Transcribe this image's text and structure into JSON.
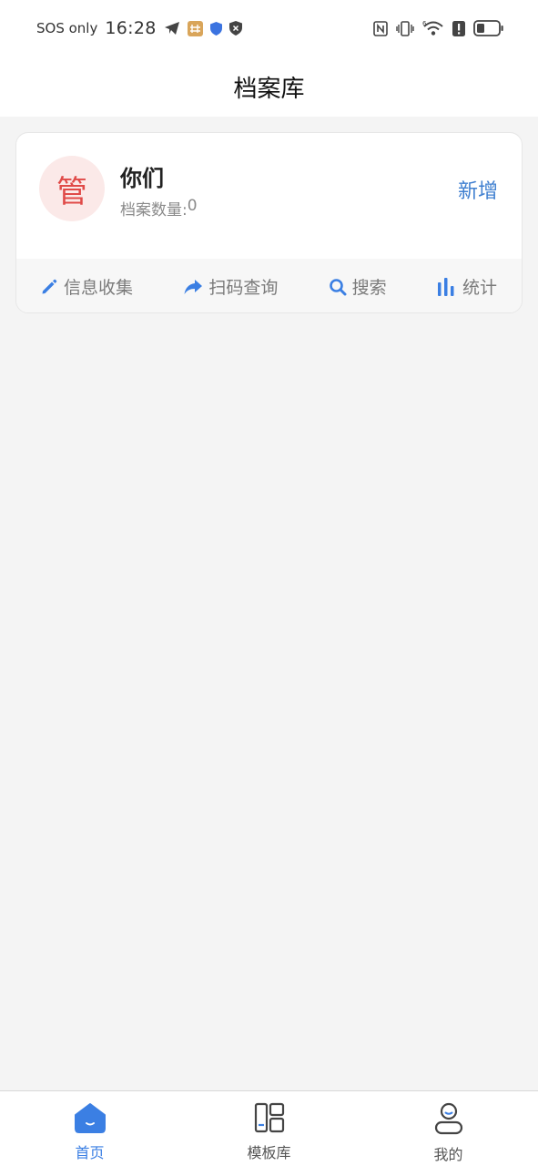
{
  "status_bar": {
    "carrier": "SOS only",
    "time": "16:28",
    "icons": [
      "telegram-icon",
      "app-notification-icon",
      "shield-icon",
      "vpn-shield-icon",
      "nfc-icon",
      "vibrate-icon",
      "wifi-icon",
      "alert-icon",
      "battery-icon"
    ]
  },
  "header": {
    "title": "档案库"
  },
  "card": {
    "avatar_char": "管",
    "name": "你们",
    "count_label": "档案数量:",
    "count_value": "0",
    "add_label": "新增",
    "actions": [
      {
        "label": "信息收集",
        "icon": "pencil-icon"
      },
      {
        "label": "扫码查询",
        "icon": "share-arrow-icon"
      },
      {
        "label": "搜索",
        "icon": "search-icon"
      },
      {
        "label": "统计",
        "icon": "bar-chart-icon"
      }
    ]
  },
  "tab_bar": {
    "tabs": [
      {
        "label": "首页",
        "icon": "home-icon",
        "active": true
      },
      {
        "label": "模板库",
        "icon": "template-icon",
        "active": false
      },
      {
        "label": "我的",
        "icon": "user-icon",
        "active": false
      }
    ]
  },
  "colors": {
    "accent": "#3b7fe3",
    "link": "#3f7fd0",
    "avatar_bg": "#fbe9e8",
    "avatar_text": "#e04a48",
    "page_bg": "#f4f4f4"
  }
}
